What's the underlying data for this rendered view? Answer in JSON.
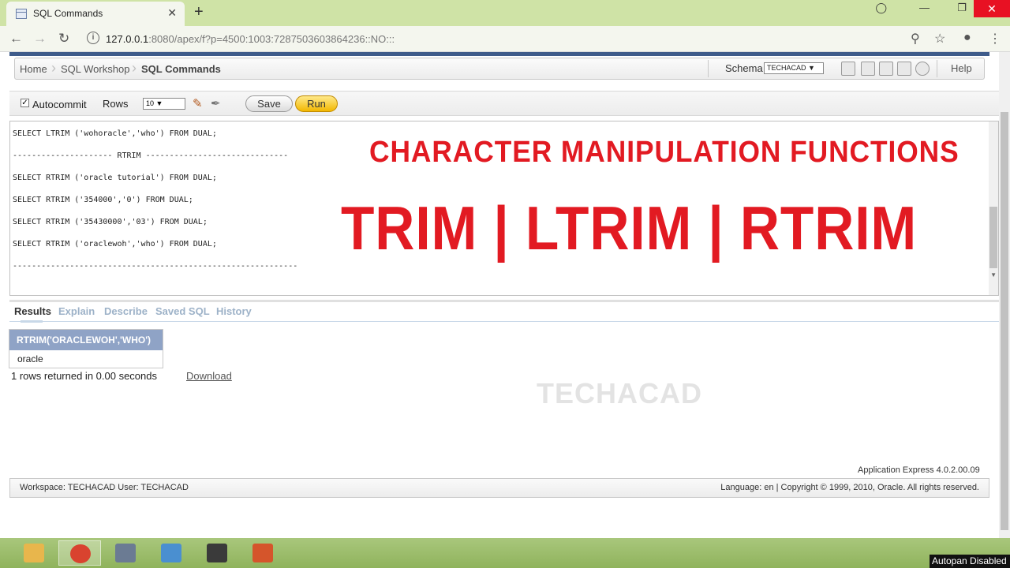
{
  "browser": {
    "tab_title": "SQL Commands",
    "url_host": "127.0.0.1",
    "url_rest": ":8080/apex/f?p=4500:1003:7287503603864236::NO:::"
  },
  "breadcrumb": {
    "items": [
      "Home",
      "SQL Workshop",
      "SQL Commands"
    ]
  },
  "schema": {
    "label": "Schema",
    "value": "TECHACAD ▼"
  },
  "help_label": "Help",
  "toolbar": {
    "autocommit_label": "Autocommit",
    "autocommit_checked": "✓",
    "rows_label": "Rows",
    "rows_value": "10 ▼",
    "save_label": "Save",
    "run_label": "Run"
  },
  "editor": {
    "lines": [
      "SELECT LTRIM ('wohoracle','who') FROM DUAL;",
      "--------------------- RTRIM ------------------------------",
      "SELECT RTRIM ('oracle tutorial') FROM DUAL;",
      "SELECT RTRIM ('354000','0') FROM DUAL;",
      "SELECT RTRIM ('35430000','03') FROM DUAL;",
      "SELECT RTRIM ('oraclewoh','who') FROM DUAL;",
      "------------------------------------------------------------"
    ]
  },
  "overlay": {
    "title": "CHARACTER MANIPULATION FUNCTIONS",
    "big": "TRIM | LTRIM | RTRIM"
  },
  "result_tabs": [
    "Results",
    "Explain",
    "Describe",
    "Saved SQL",
    "History"
  ],
  "results": {
    "column_header": "RTRIM('ORACLEWOH','WHO')",
    "cell": "oracle",
    "summary": "1 rows returned in 0.00 seconds",
    "download_label": "Download"
  },
  "watermark": "TECHACAD",
  "footer": {
    "version": "Application Express 4.0.2.00.09",
    "left": "Workspace: TECHACAD User: TECHACAD",
    "right": "Language: en | Copyright © 1999, 2010, Oracle. All rights reserved."
  },
  "taskbar": {
    "autopan": "Autopan Disabled",
    "colors": [
      "#e8b64c",
      "#d9432f",
      "#6b7b93",
      "#4a8fd0",
      "#3a3a3a",
      "#d5552b"
    ]
  }
}
